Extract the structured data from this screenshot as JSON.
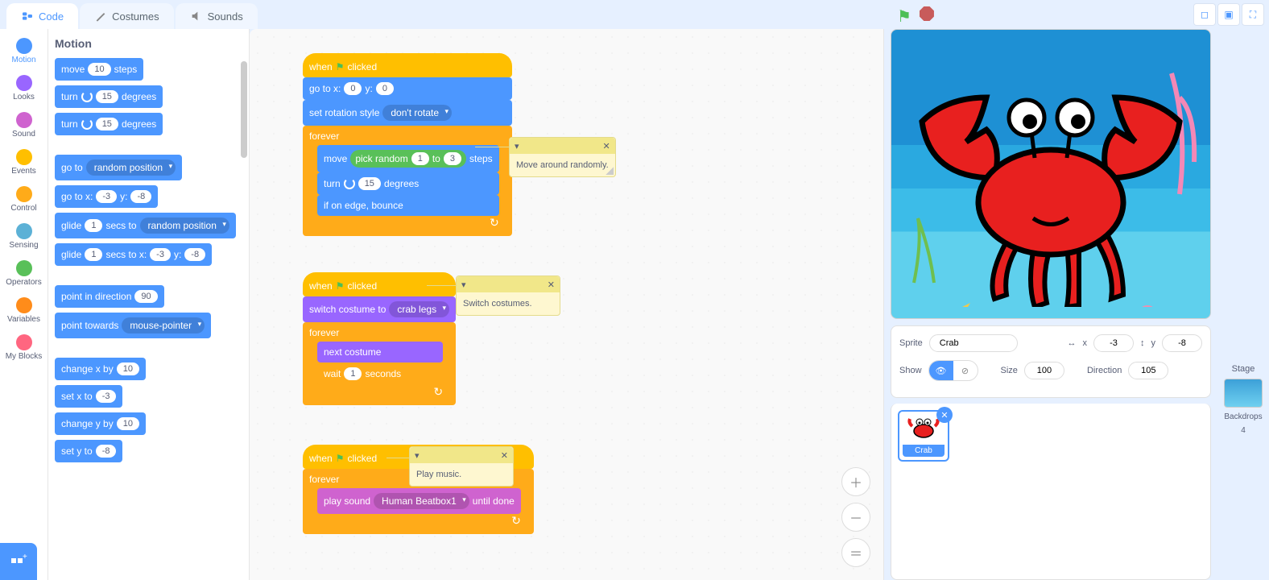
{
  "tabs": {
    "code": "Code",
    "costumes": "Costumes",
    "sounds": "Sounds"
  },
  "categories": [
    {
      "name": "Motion",
      "color": "#4c97ff"
    },
    {
      "name": "Looks",
      "color": "#9966ff"
    },
    {
      "name": "Sound",
      "color": "#cf63cf"
    },
    {
      "name": "Events",
      "color": "#ffbf00"
    },
    {
      "name": "Control",
      "color": "#ffab19"
    },
    {
      "name": "Sensing",
      "color": "#5cb1d6"
    },
    {
      "name": "Operators",
      "color": "#59c059"
    },
    {
      "name": "Variables",
      "color": "#ff8c1a"
    },
    {
      "name": "My Blocks",
      "color": "#ff6680"
    }
  ],
  "palette": {
    "title": "Motion",
    "blocks": {
      "move_label1": "move",
      "move_val": "10",
      "move_label2": "steps",
      "turncw_label1": "turn",
      "turncw_val": "15",
      "turncw_label2": "degrees",
      "turnccw_label1": "turn",
      "turnccw_val": "15",
      "turnccw_label2": "degrees",
      "goto_label": "go to",
      "goto_val": "random position",
      "gotoxy_label1": "go to x:",
      "gotoxy_x": "-3",
      "gotoxy_label2": "y:",
      "gotoxy_y": "-8",
      "glide_label1": "glide",
      "glide_secs": "1",
      "glide_label2": "secs to",
      "glide_target": "random position",
      "glidexy_label1": "glide",
      "glidexy_secs": "1",
      "glidexy_label2": "secs to x:",
      "glidexy_x": "-3",
      "glidexy_label3": "y:",
      "glidexy_y": "-8",
      "point_dir_label": "point in direction",
      "point_dir_val": "90",
      "point_tw_label": "point towards",
      "point_tw_val": "mouse-pointer",
      "changex_label": "change x by",
      "changex_val": "10",
      "setx_label": "set x to",
      "setx_val": "-3",
      "changey_label": "change y by",
      "changey_val": "10",
      "sety_label": "set y to",
      "sety_val": "-8"
    }
  },
  "scripts": {
    "s1": {
      "hat": "when",
      "hat2": "clicked",
      "gotoxy_l1": "go to x:",
      "gotoxy_x": "0",
      "gotoxy_l2": "y:",
      "gotoxy_y": "0",
      "rot_l": "set rotation style",
      "rot_v": "don't rotate",
      "forever": "forever",
      "move_l1": "move",
      "pick_l1": "pick random",
      "pick_a": "1",
      "pick_l2": "to",
      "pick_b": "3",
      "move_l2": "steps",
      "turn_l1": "turn",
      "turn_v": "15",
      "turn_l2": "degrees",
      "bounce": "if on edge, bounce"
    },
    "s2": {
      "hat": "when",
      "hat2": "clicked",
      "switch_l": "switch costume to",
      "switch_v": "crab legs",
      "forever": "forever",
      "next": "next costume",
      "wait_l1": "wait",
      "wait_v": "1",
      "wait_l2": "seconds"
    },
    "s3": {
      "hat": "when",
      "hat2": "clicked",
      "forever": "forever",
      "play_l1": "play sound",
      "play_v": "Human Beatbox1",
      "play_l2": "until done"
    }
  },
  "comments": {
    "c1": "Move around randomly.",
    "c2": "Switch costumes.",
    "c3": "Play music."
  },
  "sprite_info": {
    "sprite_label": "Sprite",
    "name": "Crab",
    "x_label": "x",
    "x_val": "-3",
    "y_label": "y",
    "y_val": "-8",
    "show_label": "Show",
    "size_label": "Size",
    "size_val": "100",
    "dir_label": "Direction",
    "dir_val": "105",
    "thumb_name": "Crab",
    "stage_label": "Stage",
    "backdrops_label": "Backdrops",
    "backdrops_count": "4"
  }
}
